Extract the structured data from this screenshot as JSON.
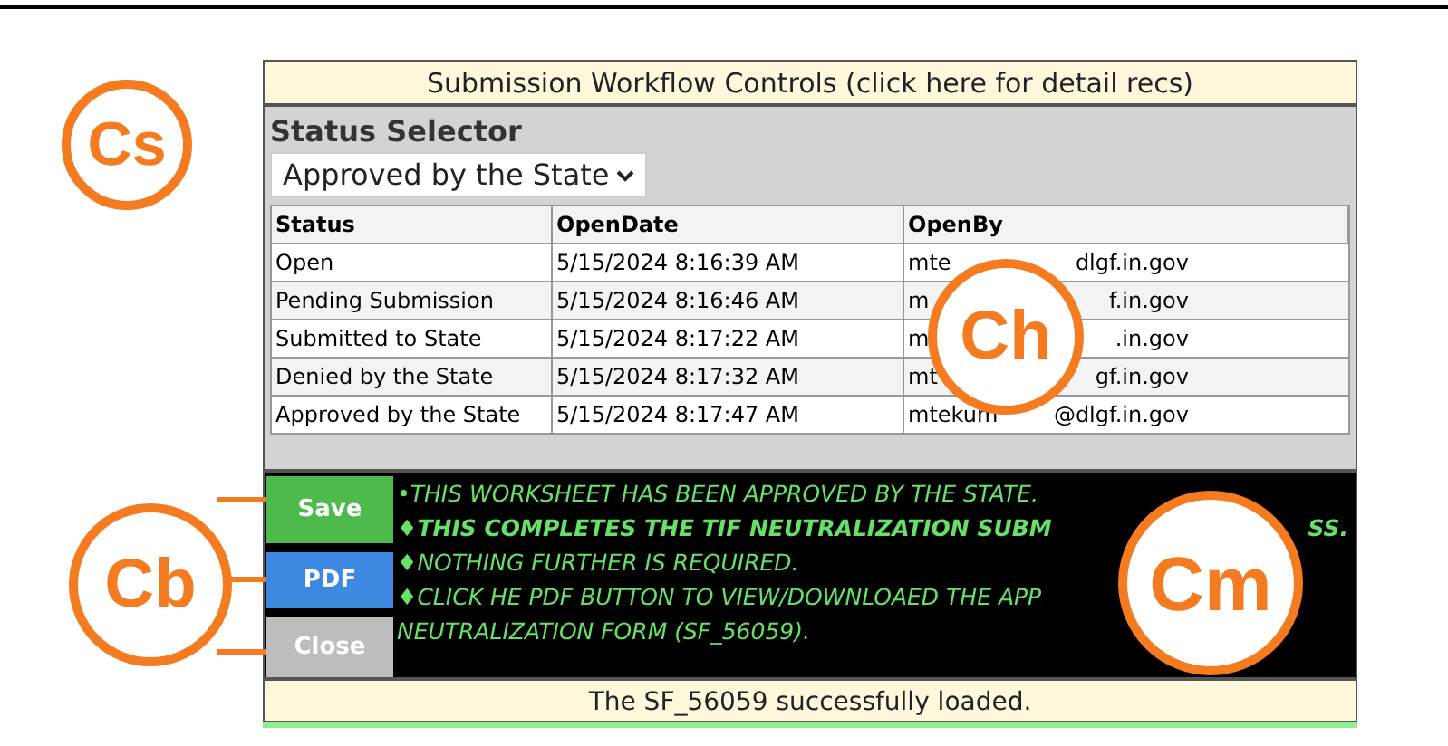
{
  "header": "Submission Workflow Controls (click here for detail recs)",
  "status_selector": {
    "title": "Status Selector",
    "value": "Approved by the State"
  },
  "table": {
    "columns": [
      "Status",
      "OpenDate",
      "OpenBy"
    ],
    "rows": [
      {
        "status": "Open",
        "open_date": "5/15/2024 8:16:39 AM",
        "open_by": [
          "mte",
          "dlgf.in.gov"
        ]
      },
      {
        "status": "Pending Submission",
        "open_date": "5/15/2024 8:16:46 AM",
        "open_by": [
          "m",
          "f.in.gov"
        ]
      },
      {
        "status": "Submitted to State",
        "open_date": "5/15/2024 8:17:22 AM",
        "open_by": [
          "m",
          ".in.gov"
        ]
      },
      {
        "status": "Denied by the State",
        "open_date": "5/15/2024 8:17:32 AM",
        "open_by": [
          "mt",
          "gf.in.gov"
        ]
      },
      {
        "status": "Approved by the State",
        "open_date": "5/15/2024 8:17:47 AM",
        "open_by": [
          "mtekum",
          "@dlgf.in.gov"
        ]
      }
    ]
  },
  "buttons": [
    {
      "label": "Save",
      "kind": "save"
    },
    {
      "label": "PDF",
      "kind": "pdf"
    },
    {
      "label": "Close",
      "kind": "close"
    }
  ],
  "messages": [
    {
      "parts": [
        "•THIS WORKSHEET HAS BEEN APPROVED BY THE STATE."
      ],
      "bold": false
    },
    {
      "parts": [
        "♦THIS COMPLETES THE TIF NEUTRALIZATION SUBM",
        "SS."
      ],
      "bold": true
    },
    {
      "parts": [
        "♦NOTHING FURTHER IS REQUIRED."
      ],
      "bold": false
    },
    {
      "parts": [
        "♦CLICK HE PDF BUTTON TO VIEW/DOWNLOAED THE APP"
      ],
      "bold": false
    },
    {
      "parts": [
        "NEUTRALIZATION FORM (SF_56059)."
      ],
      "bold": false
    }
  ],
  "status_message": "The SF_56059 successfully loaded.",
  "callouts": [
    {
      "label": "Cs"
    },
    {
      "label": "Ch"
    },
    {
      "label": "Cb"
    },
    {
      "label": "Cm"
    }
  ]
}
